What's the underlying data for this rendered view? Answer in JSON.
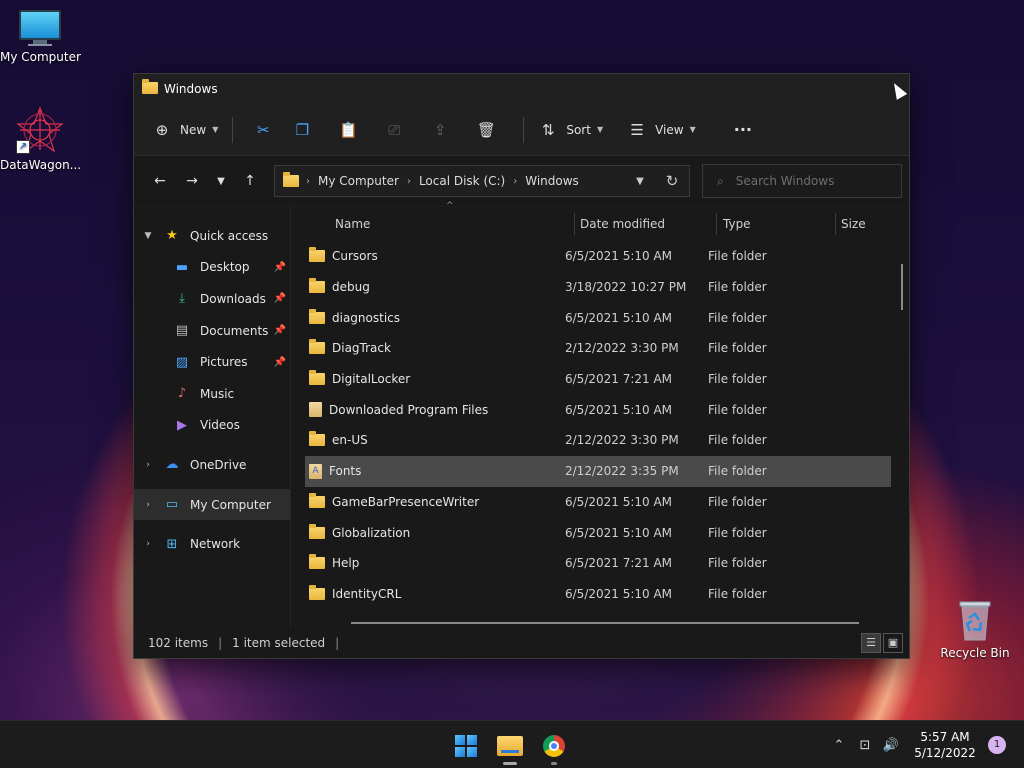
{
  "desktop": {
    "icons": [
      {
        "label": "My Computer",
        "icon": "monitor-icon"
      },
      {
        "label": "DataWagon...",
        "icon": "datawagon-icon"
      },
      {
        "label": "Recycle Bin",
        "icon": "recycle-bin-icon"
      }
    ]
  },
  "window": {
    "title": "Windows",
    "toolbar": {
      "new_label": "New",
      "sort_label": "Sort",
      "view_label": "View",
      "more_label": "···"
    },
    "address": {
      "crumbs": [
        "My Computer",
        "Local Disk (C:)",
        "Windows"
      ]
    },
    "search": {
      "placeholder": "Search Windows"
    },
    "nav": {
      "quick_access": "Quick access",
      "items": [
        {
          "label": "Desktop",
          "pinned": true
        },
        {
          "label": "Downloads",
          "pinned": true
        },
        {
          "label": "Documents",
          "pinned": true
        },
        {
          "label": "Pictures",
          "pinned": true
        },
        {
          "label": "Music",
          "pinned": false
        },
        {
          "label": "Videos",
          "pinned": false
        }
      ],
      "onedrive": "OneDrive",
      "my_computer": "My Computer",
      "network": "Network"
    },
    "columns": {
      "name": "Name",
      "date": "Date modified",
      "type": "Type",
      "size": "Size"
    },
    "files": [
      {
        "name": "Cursors",
        "date": "6/5/2021 5:10 AM",
        "type": "File folder",
        "kind": "folder"
      },
      {
        "name": "debug",
        "date": "3/18/2022 10:27 PM",
        "type": "File folder",
        "kind": "folder"
      },
      {
        "name": "diagnostics",
        "date": "6/5/2021 5:10 AM",
        "type": "File folder",
        "kind": "folder"
      },
      {
        "name": "DiagTrack",
        "date": "2/12/2022 3:30 PM",
        "type": "File folder",
        "kind": "folder"
      },
      {
        "name": "DigitalLocker",
        "date": "6/5/2021 7:21 AM",
        "type": "File folder",
        "kind": "folder"
      },
      {
        "name": "Downloaded Program Files",
        "date": "6/5/2021 5:10 AM",
        "type": "File folder",
        "kind": "doc"
      },
      {
        "name": "en-US",
        "date": "2/12/2022 3:30 PM",
        "type": "File folder",
        "kind": "folder"
      },
      {
        "name": "Fonts",
        "date": "2/12/2022 3:35 PM",
        "type": "File folder",
        "kind": "font",
        "selected": true
      },
      {
        "name": "GameBarPresenceWriter",
        "date": "6/5/2021 5:10 AM",
        "type": "File folder",
        "kind": "folder"
      },
      {
        "name": "Globalization",
        "date": "6/5/2021 5:10 AM",
        "type": "File folder",
        "kind": "folder"
      },
      {
        "name": "Help",
        "date": "6/5/2021 7:21 AM",
        "type": "File folder",
        "kind": "folder"
      },
      {
        "name": "IdentityCRL",
        "date": "6/5/2021 5:10 AM",
        "type": "File folder",
        "kind": "folder"
      }
    ],
    "status": {
      "items": "102 items",
      "selected": "1 item selected"
    }
  },
  "taskbar": {
    "time": "5:57 AM",
    "date": "5/12/2022",
    "notification_count": "1"
  },
  "colors": {
    "accent": "#1f7ad6",
    "window_bg": "#1e1e1e",
    "selected_row": "#4a4a4a",
    "folder": "#f9d36b"
  }
}
